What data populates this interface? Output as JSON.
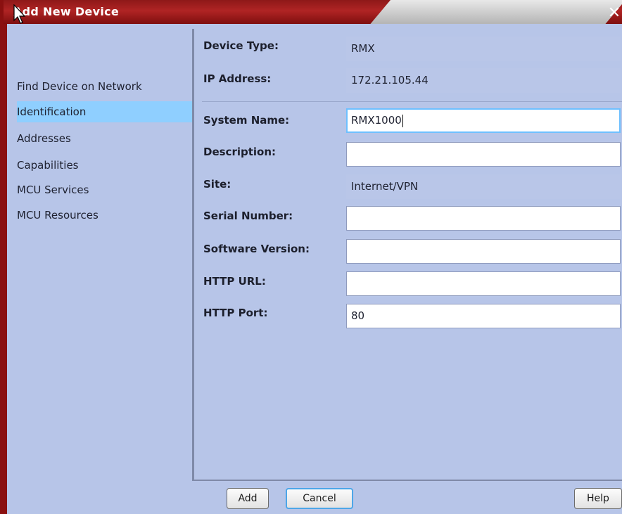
{
  "window": {
    "title": "Add New Device"
  },
  "nav": {
    "items": [
      {
        "label": "Find Device on Network",
        "active": false
      },
      {
        "label": "Identification",
        "active": true
      },
      {
        "label": "Addresses",
        "active": false
      },
      {
        "label": "Capabilities",
        "active": false
      },
      {
        "label": "MCU Services",
        "active": false
      },
      {
        "label": "MCU Resources",
        "active": false
      }
    ]
  },
  "form": {
    "device_type": {
      "label": "Device Type:",
      "value": "RMX"
    },
    "ip_address": {
      "label": "IP Address:",
      "value": "172.21.105.44"
    },
    "system_name": {
      "label": "System Name:",
      "value": "RMX1000"
    },
    "description": {
      "label": "Description:",
      "value": ""
    },
    "site": {
      "label": "Site:",
      "value": "Internet/VPN"
    },
    "serial_number": {
      "label": "Serial Number:",
      "value": ""
    },
    "software_version": {
      "label": "Software Version:",
      "value": ""
    },
    "http_url": {
      "label": "HTTP URL:",
      "value": ""
    },
    "http_port": {
      "label": "HTTP Port:",
      "value": "80"
    }
  },
  "buttons": {
    "add": "Add",
    "cancel": "Cancel",
    "help": "Help"
  },
  "colors": {
    "title_bar": "#a01c1c",
    "panel_bg": "#b7c5e8",
    "nav_selected": "#8fcfff",
    "focus_border": "#6ec0ff"
  },
  "icons": {
    "close": "close-icon",
    "cursor": "mouse-pointer-icon"
  }
}
